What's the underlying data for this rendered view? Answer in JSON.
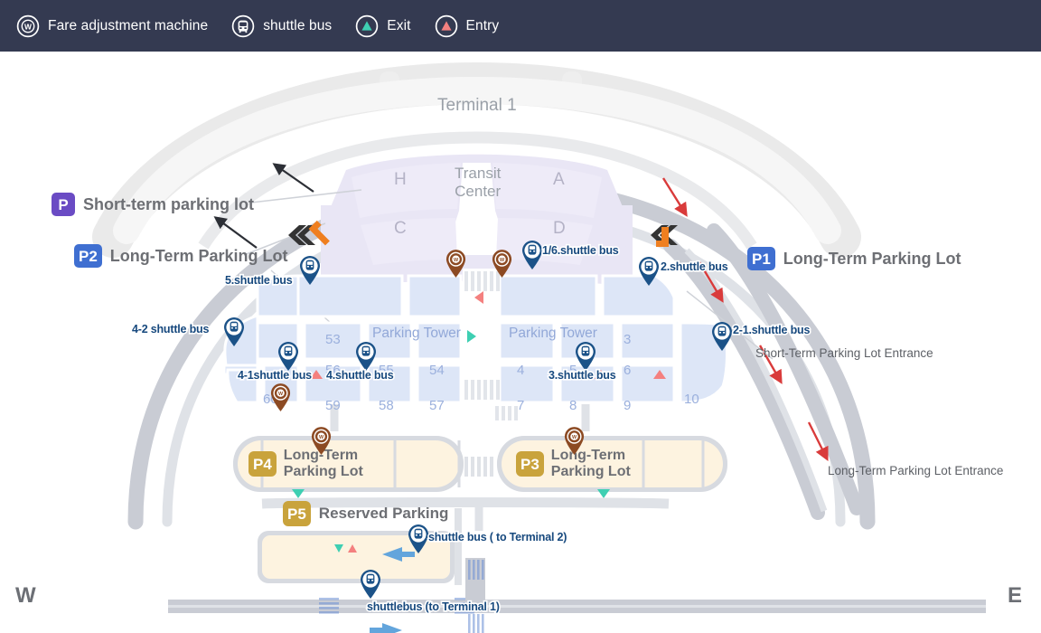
{
  "legend": {
    "items": [
      {
        "icon": "fare-adjustment-machine-icon",
        "label": "Fare adjustment machine"
      },
      {
        "icon": "shuttle-bus-icon",
        "label": "shuttle bus"
      },
      {
        "icon": "exit-icon",
        "label": "Exit"
      },
      {
        "icon": "entry-icon",
        "label": "Entry"
      }
    ],
    "background": "#343a51"
  },
  "map": {
    "terminal": {
      "title": "Terminal 1"
    },
    "transit_center": {
      "title_line1": "Transit",
      "title_line2": "Center",
      "zones": [
        "H",
        "A",
        "C",
        "D"
      ]
    },
    "parking_towers": [
      {
        "label": "Parking Tower"
      },
      {
        "label": "Parking Tower"
      }
    ],
    "stalls_left": [
      "53",
      "56",
      "55",
      "54",
      "60",
      "59",
      "58",
      "57"
    ],
    "stalls_right": [
      "3",
      "4",
      "5",
      "6",
      "7",
      "8",
      "9",
      "10"
    ],
    "lot_labels": [
      {
        "badge": "P",
        "badge_color": "#6a4bc4",
        "text": "Short-term parking lot"
      },
      {
        "badge": "P2",
        "badge_color": "#3f6fd1",
        "text": "Long-Term Parking Lot"
      },
      {
        "badge": "P1",
        "badge_color": "#3f6fd1",
        "text": "Long-Term Parking Lot"
      }
    ],
    "lots_inline": [
      {
        "badge": "P4",
        "badge_color": "#c9a33c",
        "line1": "Long-Term",
        "line2": "Parking Lot"
      },
      {
        "badge": "P3",
        "badge_color": "#c9a33c",
        "line1": "Long-Term",
        "line2": "Parking Lot"
      },
      {
        "badge": "P5",
        "badge_color": "#c9a33c",
        "line1": "Reserved Parking",
        "line2": ""
      }
    ],
    "notes": [
      {
        "text": "Short-Term Parking Lot Entrance"
      },
      {
        "text": "Long-Term Parking Lot Entrance"
      }
    ],
    "shuttle_stops": [
      {
        "label": "5.shuttle bus"
      },
      {
        "label": "4-2 shuttle bus"
      },
      {
        "label": "4-1shuttle bus"
      },
      {
        "label": "4.shuttle bus"
      },
      {
        "label": "1/6.shuttle bus"
      },
      {
        "label": "2.shuttle bus"
      },
      {
        "label": "2-1.shuttle bus"
      },
      {
        "label": "3.shuttle bus"
      },
      {
        "label": "shuttle bus ( to Terminal 2)"
      },
      {
        "label": "shuttlebus (to Terminal 1)"
      }
    ],
    "compass": {
      "west": "W",
      "east": "E"
    },
    "colors": {
      "road": "#c9ccd4",
      "parking_fill": "#dde6f7",
      "longterm_fill": "#fdf3e0",
      "terminal_fill": "#f0f0f0",
      "transit_fill": "#e8e5f5",
      "entry_marker": "#f4807f",
      "exit_marker": "#3ecfb2",
      "pin_blue": "#1b5288",
      "pin_brown": "#8c4a23",
      "chevron_dark": "#333333",
      "chevron_orange": "#ef7f20",
      "arrow_red": "#d93b3b",
      "arrow_dark": "#2c2f36",
      "arrow_blue": "#63a5dc"
    }
  }
}
